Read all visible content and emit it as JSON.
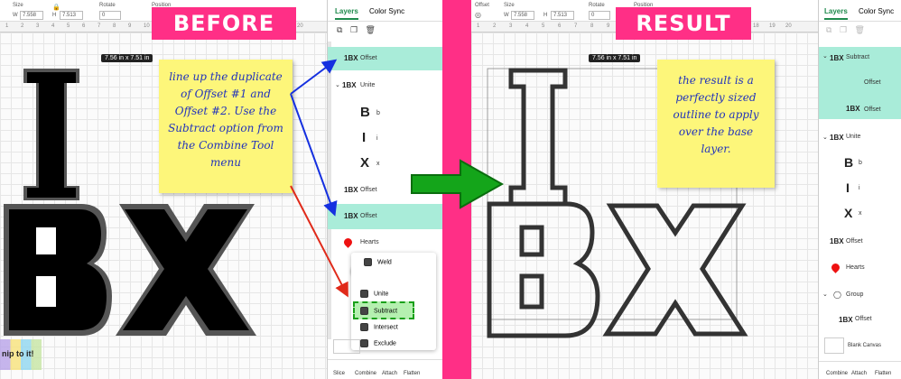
{
  "left": {
    "topbar": {
      "size_label": "Size",
      "w_label": "W",
      "w_value": "7.558",
      "h_label": "H",
      "h_value": "7.513",
      "rotate_label": "Rotate",
      "rotate_value": "0",
      "position_label": "Position",
      "position_value": "X"
    },
    "ruler_numbers": [
      "1",
      "2",
      "3",
      "4",
      "5",
      "6",
      "7",
      "8",
      "9",
      "10",
      "11",
      "12",
      "13",
      "14",
      "15",
      "16",
      "17",
      "18",
      "19",
      "20"
    ],
    "banner": "BEFORE",
    "dim_tag": "7.56  in x 7.51  in",
    "note": "line up the duplicate of Offset #1 and Offset #2. Use the Subtract option from the Combine Tool menu",
    "art": {
      "top": "I",
      "bottom": "BX"
    },
    "layers": {
      "tabs": [
        "Layers",
        "Color Sync"
      ],
      "rows": [
        {
          "icon": "1BX",
          "label": "Offset"
        },
        {
          "icon": "1BX",
          "label": "Unite"
        },
        {
          "icon": "B",
          "label": "b"
        },
        {
          "icon": "I",
          "label": "i"
        },
        {
          "icon": "X",
          "label": "x"
        },
        {
          "icon": "1BX",
          "label": "Offset"
        },
        {
          "icon": "1BX",
          "label": "Offset"
        },
        {
          "icon": "heart",
          "label": "Hearts"
        }
      ],
      "menu": [
        "Weld",
        "Unite",
        "Subtract",
        "Intersect",
        "Exclude"
      ],
      "bottom_tools": [
        "Slice",
        "Combine",
        "Attach",
        "Flatten"
      ]
    },
    "logo_text": "nip to it!"
  },
  "right": {
    "topbar": {
      "offset_label": "Offset",
      "size_label": "Size",
      "w_label": "W",
      "w_value": "7.558",
      "h_label": "H",
      "h_value": "7.513",
      "rotate_label": "Rotate",
      "rotate_value": "0",
      "position_label": "Position",
      "position_value": "X"
    },
    "ruler_numbers": [
      "1",
      "2",
      "3",
      "4",
      "5",
      "6",
      "7",
      "8",
      "9",
      "10",
      "11",
      "12",
      "13",
      "14",
      "15",
      "16",
      "17",
      "18",
      "19",
      "20"
    ],
    "banner": "RESULT",
    "dim_tag": "7.56  in x 7.51  in",
    "note": "the result is a perfectly sized outline to apply over the base layer.",
    "art": {
      "top": "I",
      "bottom": "BX"
    },
    "layers": {
      "tabs": [
        "Layers",
        "Color Sync"
      ],
      "rows": [
        {
          "icon": "1BX",
          "label": "Subtract"
        },
        {
          "icon": "",
          "label": "Offset"
        },
        {
          "icon": "1BX",
          "label": "Offset"
        },
        {
          "icon": "1BX",
          "label": "Unite"
        },
        {
          "icon": "B",
          "label": "b"
        },
        {
          "icon": "I",
          "label": "i"
        },
        {
          "icon": "X",
          "label": "x"
        },
        {
          "icon": "1BX",
          "label": "Offset"
        },
        {
          "icon": "heart",
          "label": "Hearts"
        },
        {
          "icon": "",
          "label": "Group"
        },
        {
          "icon": "1BX",
          "label": "Offset"
        },
        {
          "icon": "",
          "label": "Blank Canvas"
        }
      ],
      "bottom_tools": [
        "Combine",
        "Attach",
        "Flatten"
      ]
    }
  },
  "colors": {
    "accent_pink": "#ff2f86",
    "selected_row": "#a9ecd9",
    "note_yellow": "#fdf67a",
    "arrow_green": "#14a51a",
    "arrow_blue": "#1530e0",
    "arrow_red": "#e02a1a"
  }
}
